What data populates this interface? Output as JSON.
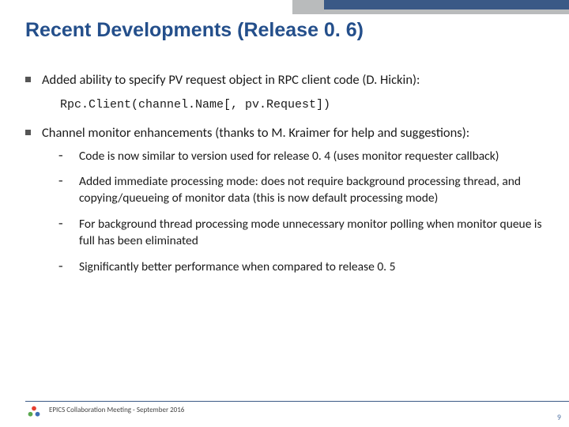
{
  "title": "Recent Developments (Release 0. 6)",
  "bullets": [
    {
      "text": "Added ability to specify PV request object in RPC client code (D. Hickin):",
      "code": "Rpc.Client(channel.Name[, pv.Request])"
    },
    {
      "text": "Channel monitor enhancements (thanks to M. Kraimer for help and suggestions):",
      "sub": [
        "Code is now similar to version used for release 0. 4 (uses monitor requester callback)",
        "Added immediate processing mode: does not require background processing thread, and copying/queueing of monitor data (this is now default processing mode)",
        "For background thread processing mode unnecessary monitor polling when monitor queue is full has been eliminated",
        "Significantly better performance when compared to release 0. 5"
      ]
    }
  ],
  "footer": "EPICS Collaboration Meeting  - September 2016",
  "page": "9"
}
